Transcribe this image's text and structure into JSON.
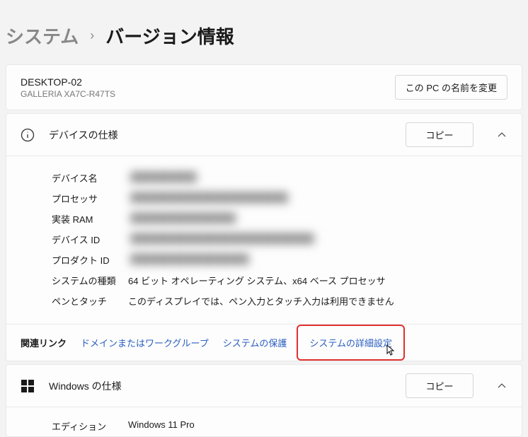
{
  "breadcrumb": {
    "parent": "システム",
    "separator": "›",
    "current": "バージョン情報"
  },
  "pc": {
    "name": "DESKTOP-02",
    "model": "GALLERIA XA7C-R47TS",
    "rename_button": "この PC の名前を変更"
  },
  "device_spec": {
    "title": "デバイスの仕様",
    "copy_button": "コピー",
    "rows": {
      "device_name": {
        "label": "デバイス名",
        "value": "██████████"
      },
      "processor": {
        "label": "プロセッサ",
        "value": "████████████████████████"
      },
      "ram": {
        "label": "実装 RAM",
        "value": "████████████████"
      },
      "device_id": {
        "label": "デバイス ID",
        "value": "████████████████████████████"
      },
      "product_id": {
        "label": "プロダクト ID",
        "value": "██████████████████"
      },
      "system_type": {
        "label": "システムの種類",
        "value": "64 ビット オペレーティング システム、x64 ベース プロセッサ"
      },
      "pen_touch": {
        "label": "ペンとタッチ",
        "value": "このディスプレイでは、ペン入力とタッチ入力は利用できません"
      }
    }
  },
  "related": {
    "label": "関連リンク",
    "domain": "ドメインまたはワークグループ",
    "protection": "システムの保護",
    "advanced": "システムの詳細設定"
  },
  "windows_spec": {
    "title": "Windows の仕様",
    "copy_button": "コピー",
    "rows": {
      "edition": {
        "label": "エディション",
        "value": "Windows 11 Pro"
      }
    }
  }
}
